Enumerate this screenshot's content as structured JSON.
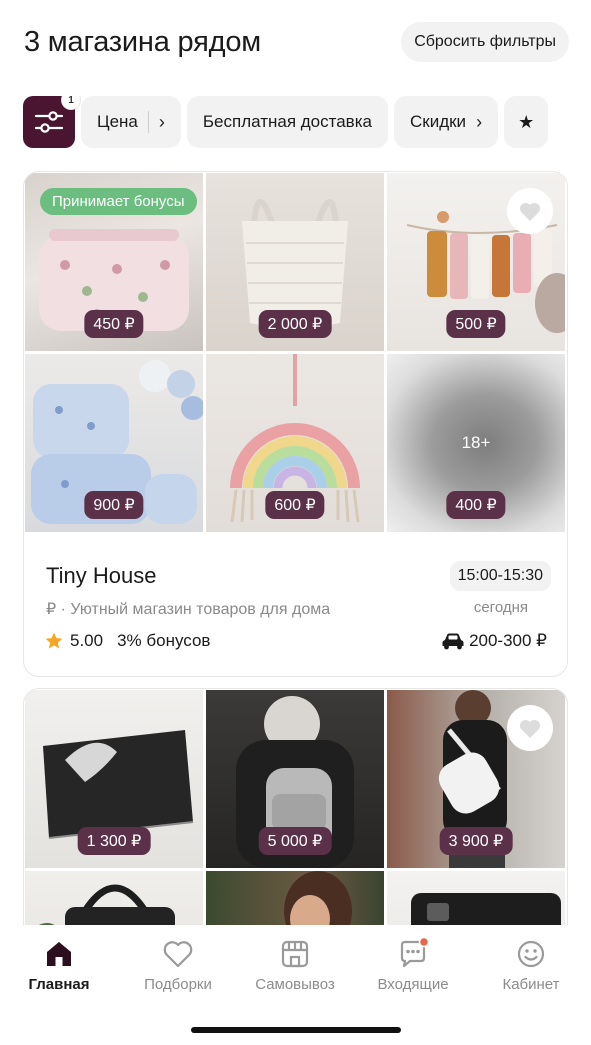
{
  "header": {
    "title": "3 магазина рядом",
    "reset_label": "Сбросить фильтры"
  },
  "filters": {
    "badge": "1",
    "chips": [
      {
        "label": "Цена"
      },
      {
        "label": "Бесплатная доставка"
      },
      {
        "label": "Скидки"
      }
    ]
  },
  "shop1": {
    "bonus_tag": "Принимает бонусы",
    "prices": [
      "450 ₽",
      "2 000 ₽",
      "500 ₽",
      "900 ₽",
      "600 ₽",
      "400 ₽"
    ],
    "adult_label": "18+",
    "name": "Tiny House",
    "description": "₽ · Уютный магазин товаров для дома",
    "time": "15:00-15:30",
    "day": "сегодня",
    "rating": "5.00",
    "bonus": "3% бонусов",
    "delivery": "200-300 ₽"
  },
  "shop2": {
    "prices": [
      "1 300 ₽",
      "5 000 ₽",
      "3 900 ₽"
    ]
  },
  "tabbar": {
    "items": [
      {
        "label": "Главная",
        "icon": "home-icon"
      },
      {
        "label": "Подборки",
        "icon": "heart-icon"
      },
      {
        "label": "Самовывоз",
        "icon": "store-icon"
      },
      {
        "label": "Входящие",
        "icon": "chat-icon"
      },
      {
        "label": "Кабинет",
        "icon": "profile-icon"
      }
    ]
  },
  "colors": {
    "accent": "#4a1530",
    "price_badge": "#5a3149",
    "bonus_tag": "#6bbd80",
    "notification": "#e8654a"
  }
}
